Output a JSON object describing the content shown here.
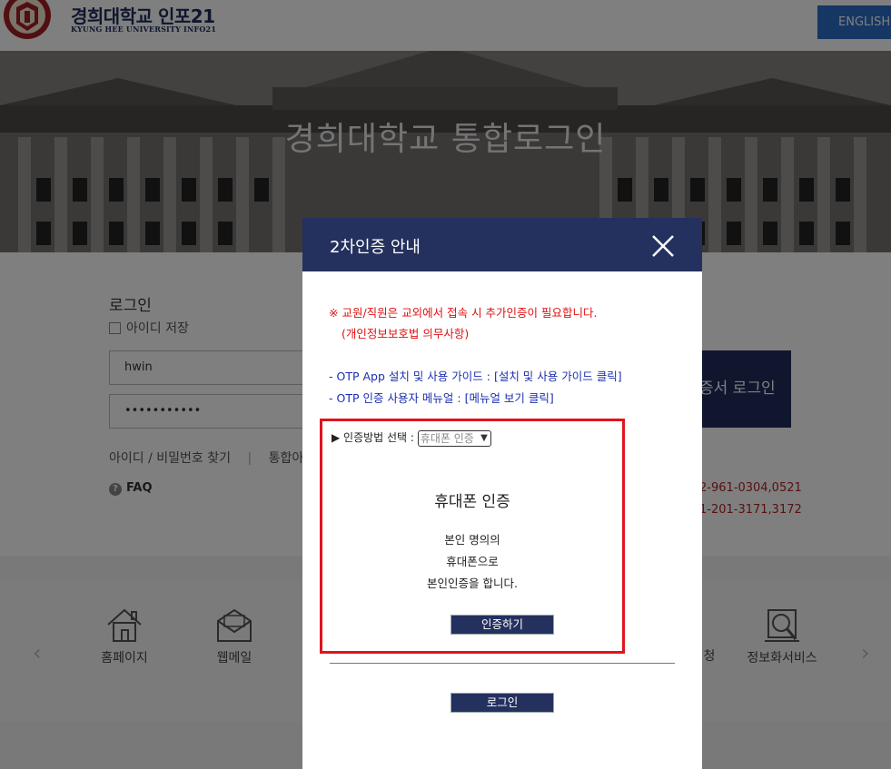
{
  "header": {
    "logo_title": "경희대학교 인포21",
    "logo_subtitle": "KYUNG HEE UNIVERSITY INFO21",
    "language_button": "ENGLISH"
  },
  "hero": {
    "title": "경희대학교 통합로그인"
  },
  "login": {
    "heading": "로그인",
    "remember_label": "아이디 저장",
    "id_value": "hwin",
    "password_value": "•••••••••••",
    "find_links": "아이디 / 비밀번호 찾기",
    "separator": "|",
    "integrated_prefix": "통합아",
    "faq": "FAQ",
    "cert_login_label": "증서 로그인",
    "phone1": "2-961-0304,0521",
    "phone2": "1-201-3171,3172"
  },
  "quick_links": {
    "items": [
      {
        "label": "홈페이지",
        "icon": "home-icon"
      },
      {
        "label": "웹메일",
        "icon": "mail-icon"
      },
      {
        "label": "청",
        "icon": "apply-icon"
      },
      {
        "label": "정보화서비스",
        "icon": "info-service-icon"
      }
    ],
    "prev": "‹",
    "next": "›"
  },
  "modal": {
    "title": "2차인증 안내",
    "notice_line1": "※ 교원/직원은 교외에서 접속 시 추가인증이 필요합니다.",
    "notice_line2": "(개인정보보호법 의무사항)",
    "guide1_text": "- OTP App 설치 및 사용 가이드 : ",
    "guide1_link": "[설치 및 사용 가이드 클릭]",
    "guide2_text": "- OTP 인증 사용자 메뉴얼 : ",
    "guide2_link": "[메뉴얼 보기 클릭]",
    "method_label": "▶ 인증방법 선택 : ",
    "method_selected": "휴대폰 인증",
    "method_title": "휴대폰 인증",
    "method_desc": [
      "본인 명의의",
      "휴대폰으로",
      "본인인증을 합니다."
    ],
    "verify_button": "인증하기",
    "login_button": "로그인"
  },
  "colors": {
    "navy": "#24305e",
    "notice_red": "#e01010",
    "link_blue": "#1b2fb0",
    "highlight_red": "#e0141e",
    "english_blue": "#2d6fc9"
  }
}
